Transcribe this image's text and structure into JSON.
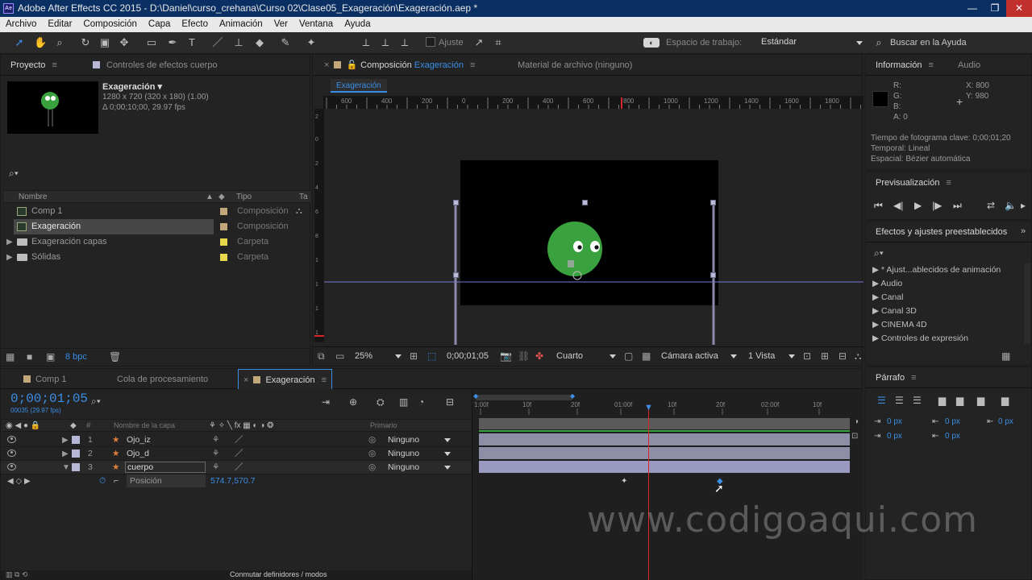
{
  "window": {
    "title": "Adobe After Effects CC 2015 - D:\\Daniel\\curso_crehana\\Curso 02\\Clase05_Exageración\\Exageración.aep *",
    "min": "—",
    "max": "❐",
    "close": "✕"
  },
  "menu": [
    "Archivo",
    "Editar",
    "Composición",
    "Capa",
    "Efecto",
    "Animación",
    "Ver",
    "Ventana",
    "Ayuda"
  ],
  "toolbar": {
    "ajuste": "Ajuste",
    "workspace_label": "Espacio de trabajo:",
    "workspace_value": "Estándar",
    "help_placeholder": "Buscar en la Ayuda"
  },
  "project": {
    "tab": "Proyecto",
    "effects_tab": "Controles de efectos cuerpo",
    "comp_name": "Exageración ▾",
    "comp_res": "1280 x 720  (320 x 180) (1.00)",
    "comp_dur": "Δ 0;00;10;00, 29.97 fps",
    "col_name": "Nombre",
    "col_type": "Tipo",
    "col_size": "Ta",
    "items": [
      {
        "name": "Comp 1",
        "type": "Composición",
        "color": "#c2a77a"
      },
      {
        "name": "Exageración",
        "type": "Composición",
        "color": "#c2a77a"
      },
      {
        "name": "Exageración capas",
        "type": "Carpeta",
        "color": "#e6d84a"
      },
      {
        "name": "Sólidas",
        "type": "Carpeta",
        "color": "#e6d84a"
      }
    ],
    "bpc": "8 bpc"
  },
  "comp": {
    "tab_prefix": "Composición",
    "tab_name": "Exageración",
    "footage_tab": "Material de archivo  (ninguno)",
    "crumb": "Exageración",
    "zoom": "25%",
    "timecode": "0;00;01;05",
    "resolution": "Cuarto",
    "camera": "Cámara activa",
    "views": "1 Vista",
    "ruler_labels": [
      "600",
      "400",
      "200",
      "0",
      "200",
      "400",
      "600",
      "800",
      "1000",
      "1200",
      "1400",
      "1600",
      "1800"
    ]
  },
  "info": {
    "tab": "Información",
    "audio_tab": "Audio",
    "r": "R:",
    "g": "G:",
    "b": "B:",
    "a": "A:  0",
    "x": "X:  800",
    "y": "Y:  980",
    "l1": "Tiempo de fotograma clave: 0;00;01;20",
    "l2": "Temporal: Lineal",
    "l3": "Espacial: Bézier automática"
  },
  "preview": {
    "tab": "Previsualización"
  },
  "effects": {
    "tab": "Efectos y ajustes preestablecidos",
    "items": [
      "* Ajust...ablecidos de animación",
      "Audio",
      "Canal",
      "Canal 3D",
      "CINEMA 4D",
      "Controles de expresión"
    ]
  },
  "timeline": {
    "tabs": [
      "Comp 1",
      "Cola de procesamiento",
      "Exageración"
    ],
    "timecode": "0;00;01;05",
    "frames": "00035 (29.97 fps)",
    "col_layer": "Nombre de la capa",
    "col_parent": "Primario",
    "layers": [
      {
        "num": "1",
        "name": "Ojo_iz",
        "parent": "Ninguno"
      },
      {
        "num": "2",
        "name": "Ojo_d",
        "parent": "Ninguno"
      },
      {
        "num": "3",
        "name": "cuerpo",
        "parent": "Ninguno"
      }
    ],
    "prop_name": "Posición",
    "prop_value": "574.7,570.7",
    "ruler": [
      "1:00f",
      "10f",
      "20f",
      "01:00f",
      "10f",
      "20f",
      "02:00f",
      "10f"
    ],
    "bottom": "Conmutar definidores / modos"
  },
  "paragraph": {
    "tab": "Párrafo",
    "v1": "0 px",
    "v2": "0 px",
    "v3": "0 px",
    "v4": "0 px",
    "v5": "0 px"
  },
  "watermark": "www.codigoaqui.com",
  "colors": {
    "accent": "#3a8ee6",
    "playhead": "#d9262b",
    "green": "#3aa13f"
  }
}
